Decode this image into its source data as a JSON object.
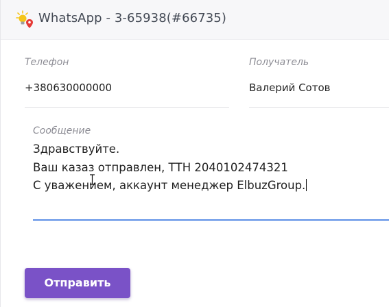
{
  "header": {
    "title": "WhatsApp - 3-65938(#66735)",
    "icon": "lightbulb-location-icon"
  },
  "form": {
    "phone": {
      "label": "Телефон",
      "value": "+380630000000"
    },
    "recipient": {
      "label": "Получатель",
      "value": "Валерий Сотов"
    },
    "message": {
      "label": "Сообщение",
      "lines": [
        "Здравствуйте.",
        "Ваш казаз отправлен, ТТН 2040102474321",
        "С уважением, аккаунт менеджер ElbuzGroup."
      ]
    }
  },
  "actions": {
    "send_label": "Отправить"
  },
  "colors": {
    "accent": "#7a52c7",
    "focus": "#5c8fe6",
    "bulb": "#f5c518",
    "pin": "#e53935"
  }
}
